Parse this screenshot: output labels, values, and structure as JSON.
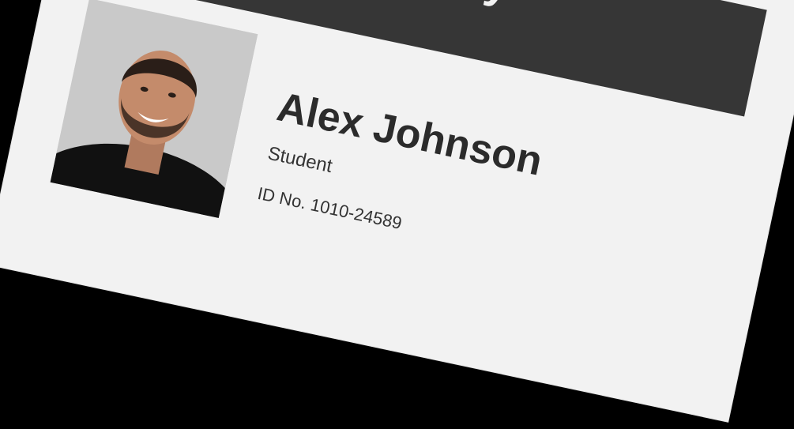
{
  "card": {
    "school_name": "Summit Academy",
    "person_name": "Alex Johnson",
    "role": "Student",
    "id_text": "ID No. 1010-24589"
  },
  "colors": {
    "background": "#000000",
    "card": "#f2f2f2",
    "header_band": "#363636",
    "text_dark": "#2b2b2b"
  },
  "icons": {
    "photo": "portrait-photo"
  }
}
